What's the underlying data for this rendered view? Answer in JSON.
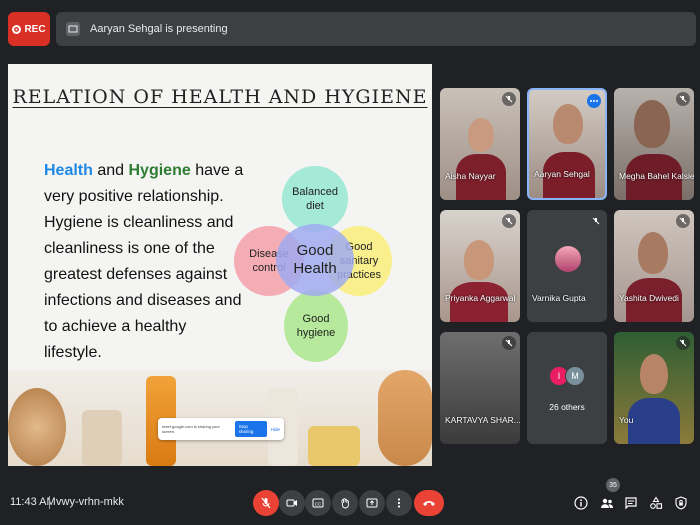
{
  "recording": {
    "label": "REC"
  },
  "presenting_bar": {
    "text": "Aaryan Sehgal is presenting"
  },
  "slide": {
    "title": "RELATION OF HEALTH AND HYGIENE",
    "body": {
      "word1": "Health",
      "and": " and ",
      "word2": "Hygiene",
      "rest": " have a very positive relationship. Hygiene is cleanliness and cleanliness is one of the greatest defenses against infections and diseases and to achieve a healthy lifestyle."
    },
    "diagram": {
      "top": "Balanced diet",
      "left": "Disease control",
      "right": "Good sanitary practices",
      "bottom": "Good hygiene",
      "center": "Good Health"
    },
    "share_notice": {
      "text": "meet.google.com is sharing your screen.",
      "stop_label": "Stop sharing",
      "hide_label": "Hide"
    }
  },
  "participants": [
    {
      "name": "Aisha Nayyar"
    },
    {
      "name": "Aaryan Sehgal"
    },
    {
      "name": "Megha Bahel Kalsie"
    },
    {
      "name": "Priyanka Aggarwal"
    },
    {
      "name": "Varnika Gupta"
    },
    {
      "name": "Yashita Dwivedi"
    },
    {
      "name": "KARTAVYA SHAR..."
    },
    {
      "name": "26 others",
      "initials": [
        "I",
        "M"
      ]
    },
    {
      "name": "You"
    }
  ],
  "bottom_bar": {
    "time": "11:43 AM",
    "meeting_code": "vwy-vrhn-mkk",
    "participant_count": "35"
  },
  "colors": {
    "accent_red": "#ea4335",
    "accent_blue": "#1a73e8",
    "health_blue": "#1e88e5",
    "hygiene_green": "#2e7d32"
  }
}
